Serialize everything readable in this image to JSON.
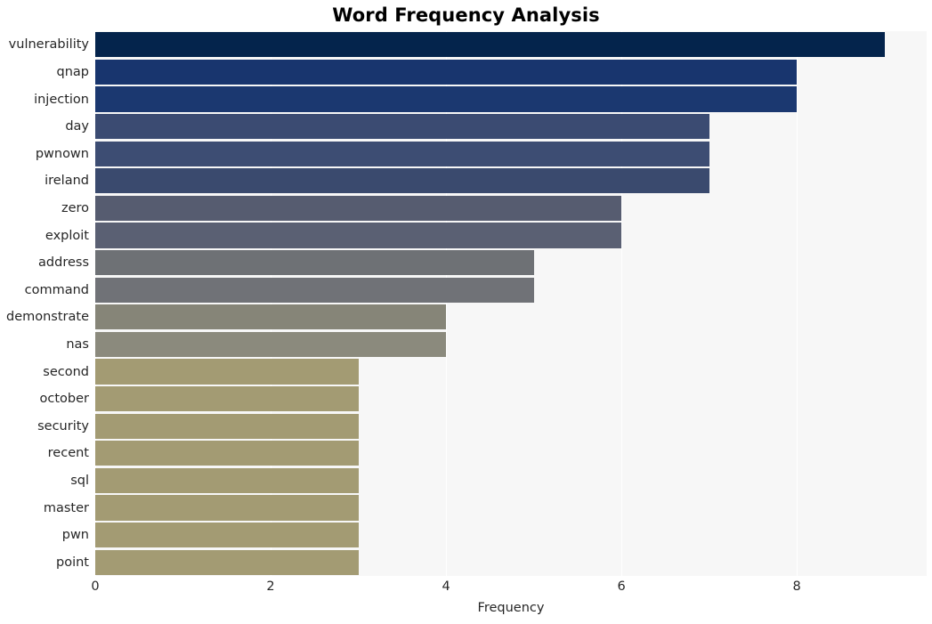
{
  "chart_data": {
    "type": "bar",
    "orientation": "horizontal",
    "title": "Word Frequency Analysis",
    "xlabel": "Frequency",
    "ylabel": "",
    "categories": [
      "vulnerability",
      "qnap",
      "injection",
      "day",
      "pwnown",
      "ireland",
      "zero",
      "exploit",
      "address",
      "command",
      "demonstrate",
      "nas",
      "second",
      "october",
      "security",
      "recent",
      "sql",
      "master",
      "pwn",
      "point"
    ],
    "values": [
      9,
      8,
      8,
      7,
      7,
      7,
      6,
      6,
      5,
      5,
      4,
      4,
      3,
      3,
      3,
      3,
      3,
      3,
      3,
      3
    ],
    "xticks": [
      "0",
      "2",
      "4",
      "6",
      "8"
    ],
    "xtick_values": [
      0,
      2,
      4,
      6,
      8
    ],
    "xlim": [
      0,
      9.48
    ],
    "grid": "vertical-white",
    "legend": "none",
    "bar_colors": [
      "#04244c",
      "#18356e",
      "#1b3870",
      "#3b4b72",
      "#3d4d73",
      "#3a4a6e",
      "#565c70",
      "#5a6073",
      "#6e7175",
      "#707277",
      "#868578",
      "#8b8a7d",
      "#a39b73",
      "#a39b73",
      "#a39b73",
      "#a39b73",
      "#a39b73",
      "#a39b73",
      "#a39b73",
      "#a39b73"
    ],
    "plot_background": "#f7f7f7",
    "gridline_color": "#ffffff",
    "text_color": "#262626",
    "figure_background": "#ffffff"
  }
}
